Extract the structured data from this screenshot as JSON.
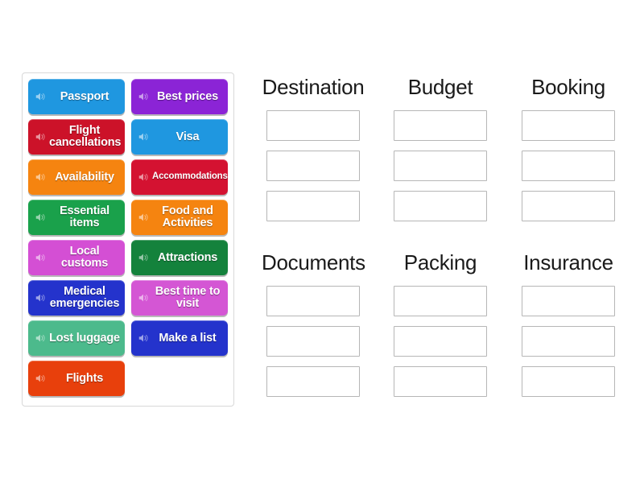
{
  "tiles": [
    {
      "label": "Passport",
      "color": "#1f97e0",
      "icon": "speaker-icon",
      "small": false
    },
    {
      "label": "Best prices",
      "color": "#8b24d6",
      "icon": "speaker-icon",
      "small": false
    },
    {
      "label": "Flight cancellations",
      "color": "#cc1229",
      "icon": "speaker-icon",
      "small": false
    },
    {
      "label": "Visa",
      "color": "#1f97e0",
      "icon": "speaker-icon",
      "small": false
    },
    {
      "label": "Availability",
      "color": "#f58410",
      "icon": "speaker-icon",
      "small": false
    },
    {
      "label": "Accommodations",
      "color": "#d41231",
      "icon": "speaker-icon",
      "small": true
    },
    {
      "label": "Essential items",
      "color": "#1aa14b",
      "icon": "speaker-icon",
      "small": false
    },
    {
      "label": "Food and Activities",
      "color": "#f58410",
      "icon": "speaker-icon",
      "small": false
    },
    {
      "label": "Local customs",
      "color": "#d44fd4",
      "icon": "speaker-icon",
      "small": false
    },
    {
      "label": "Attractions",
      "color": "#14823c",
      "icon": "speaker-icon",
      "small": false
    },
    {
      "label": "Medical emergencies",
      "color": "#2433cc",
      "icon": "speaker-icon",
      "small": false
    },
    {
      "label": "Best time to visit",
      "color": "#d456d4",
      "icon": "speaker-icon",
      "small": false
    },
    {
      "label": "Lost luggage",
      "color": "#4cba8c",
      "icon": "speaker-icon",
      "small": false
    },
    {
      "label": "Make a list",
      "color": "#2433cc",
      "icon": "speaker-icon",
      "small": false
    },
    {
      "label": "Flights",
      "color": "#e8400c",
      "icon": "speaker-icon",
      "small": false
    }
  ],
  "zones": [
    {
      "title": "Destination",
      "slots": [
        "",
        "",
        ""
      ]
    },
    {
      "title": "Budget",
      "slots": [
        "",
        "",
        ""
      ]
    },
    {
      "title": "Booking",
      "slots": [
        "",
        "",
        ""
      ]
    },
    {
      "title": "Documents",
      "slots": [
        "",
        "",
        ""
      ]
    },
    {
      "title": "Packing",
      "slots": [
        "",
        "",
        ""
      ]
    },
    {
      "title": "Insurance",
      "slots": [
        "",
        "",
        ""
      ]
    }
  ],
  "colors": {
    "page_background": "#ffffff",
    "panel_border": "#d8d8d8",
    "drop_box_border": "#b6b6b6",
    "title_text": "#1a1a1a",
    "tile_text": "#ffffff"
  }
}
